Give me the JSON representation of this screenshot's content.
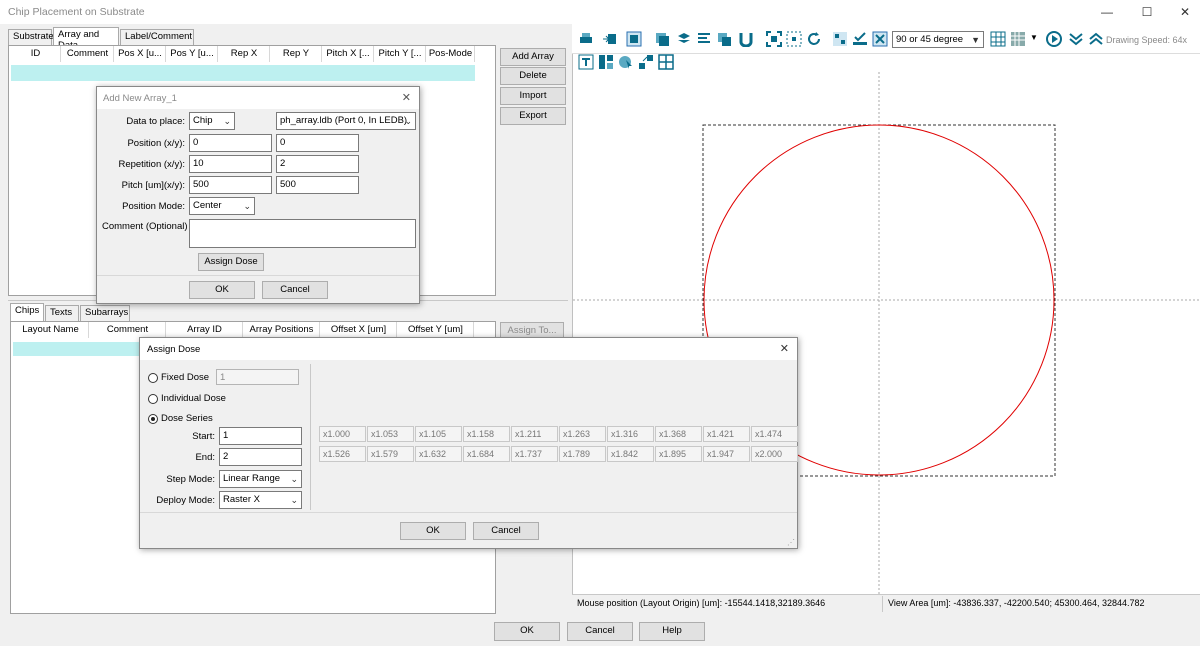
{
  "window": {
    "title": "Chip Placement on Substrate",
    "minimize": "—",
    "maximize": "☐",
    "close": "✕"
  },
  "top_tabs": [
    "Substrate",
    "Array and Data",
    "Label/Comment"
  ],
  "array_table": {
    "columns": [
      "ID",
      "Comment",
      "Pos X [u...",
      "Pos Y [u...",
      "Rep X",
      "Rep Y",
      "Pitch X [...",
      "Pitch Y [...",
      "Pos-Mode"
    ]
  },
  "array_buttons": {
    "add": "Add Array",
    "delete": "Delete",
    "import": "Import",
    "export": "Export"
  },
  "bottom_tabs": [
    "Chips",
    "Texts",
    "Subarrays"
  ],
  "chips_table": {
    "columns": [
      "Layout Name",
      "Comment",
      "Array ID",
      "Array Positions",
      "Offset X [um]",
      "Offset Y [um]"
    ]
  },
  "assign_to": "Assign To...",
  "add_array_dialog": {
    "title": "Add New Array_1",
    "close": "✕",
    "data_label": "Data to place:",
    "data_type": "Chip",
    "data_source": "ph_array.ldb (Port 0, In LEDB)",
    "position_label": "Position (x/y):",
    "pos_x": "0",
    "pos_y": "0",
    "repetition_label": "Repetition (x/y):",
    "rep_x": "10",
    "rep_y": "2",
    "pitch_label": "Pitch [um](x/y):",
    "pitch_x": "500",
    "pitch_y": "500",
    "mode_label": "Position Mode:",
    "mode": "Center",
    "comment_label": "Comment (Optional)",
    "assign_dose": "Assign Dose",
    "ok": "OK",
    "cancel": "Cancel"
  },
  "dose_dialog": {
    "title": "Assign Dose",
    "close": "✕",
    "fixed": "Fixed Dose",
    "fixed_value": "1",
    "individual": "Individual Dose",
    "series": "Dose Series",
    "selected": "series",
    "start_label": "Start:",
    "start": "1",
    "end_label": "End:",
    "end": "2",
    "step_label": "Step Mode:",
    "step": "Linear Range",
    "deploy_label": "Deploy Mode:",
    "deploy": "Raster X",
    "row1": [
      "x1.000",
      "x1.053",
      "x1.105",
      "x1.158",
      "x1.211",
      "x1.263",
      "x1.316",
      "x1.368",
      "x1.421",
      "x1.474"
    ],
    "row2": [
      "x1.526",
      "x1.579",
      "x1.632",
      "x1.684",
      "x1.737",
      "x1.789",
      "x1.842",
      "x1.895",
      "x1.947",
      "x2.000"
    ],
    "ok": "OK",
    "cancel": "Cancel"
  },
  "toolbar": {
    "angle": "90 or 45 degree",
    "drawing_speed": "Drawing Speed: 64x"
  },
  "status": {
    "mouse": "Mouse position (Layout Origin) [um]: -15544.1418,32189.3646",
    "view": "View Area [um]: -43836.337, -42200.540; 45300.464, 32844.782"
  },
  "footer": {
    "ok": "OK",
    "cancel": "Cancel",
    "help": "Help"
  },
  "colors": {
    "accent": "#0a6c8a",
    "selection": "#bdf0f0",
    "wafer": "#e00000"
  }
}
